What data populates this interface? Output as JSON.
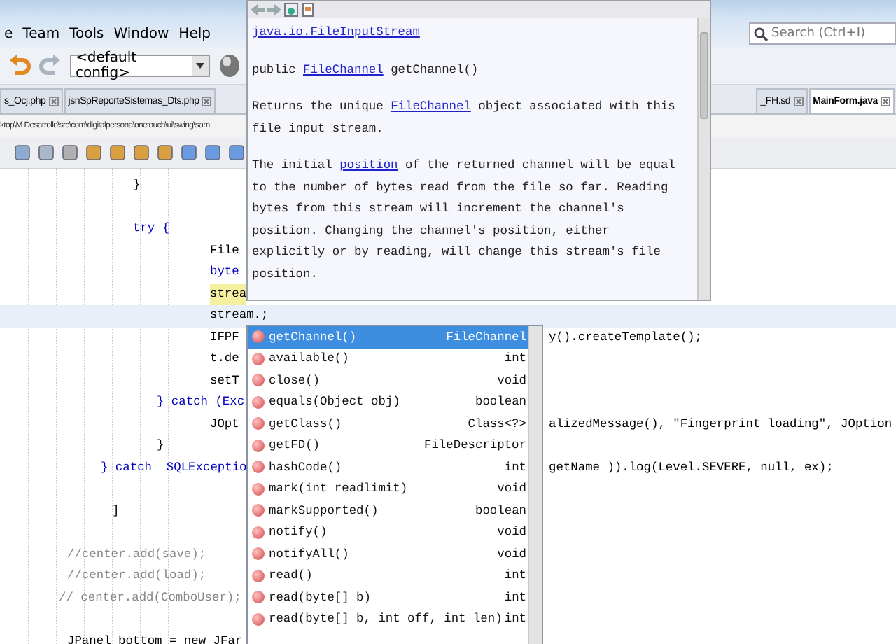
{
  "menu": [
    "e",
    "Team",
    "Tools",
    "Window",
    "Help"
  ],
  "search": {
    "placeholder": "Search (Ctrl+I)"
  },
  "toolbar": {
    "config": "<default config>"
  },
  "tabs_left": [
    {
      "label": "s_Ocj.php",
      "selected": false
    },
    {
      "label": "jsnSpReporteSistemas_Dts.php",
      "selected": false
    }
  ],
  "tabs_right": [
    {
      "label": "_FH.sd",
      "selected": false
    },
    {
      "label": "MainForm.java",
      "selected": true
    }
  ],
  "path": "ktop\\M Desarrollo\\src\\com\\digitalpersona\\onetouch\\ui\\swing\\sam",
  "code_lines": [
    {
      "left": "}",
      "kind": "code"
    },
    {
      "kind": "code"
    },
    {
      "left": "try {",
      "kind": "keyword"
    },
    {
      "left": "File",
      "kind": "code"
    },
    {
      "left": "byte",
      "kind": "keyword"
    },
    {
      "left": "strea",
      "kind": "occurrence"
    },
    {
      "left": "stream.;",
      "kind": "current"
    },
    {
      "left": "IFPF",
      "right": "y().createTemplate();",
      "kind": "code"
    },
    {
      "left": "t.de",
      "kind": "code"
    },
    {
      "left": "setT",
      "kind": "code"
    },
    {
      "left": "} catch (Exc",
      "kind": "keyword"
    },
    {
      "left": "JOpt",
      "right": "alizedMessage(), \"Fingerprint loading\", JOption",
      "kind": "code"
    },
    {
      "left": "}",
      "kind": "code"
    },
    {
      "left": "} catch  SQLExceptio",
      "right": "getName )).log(Level.SEVERE, null, ex);",
      "kind": "keyword"
    },
    {
      "kind": "code"
    },
    {
      "left": "]",
      "kind": "code"
    },
    {
      "kind": "code"
    },
    {
      "left": "//center.add(save);",
      "kind": "comment"
    },
    {
      "left": "//center.add(load);",
      "kind": "comment"
    },
    {
      "left": "// center.add(ComboUser);",
      "kind": "comment"
    },
    {
      "kind": "code"
    },
    {
      "left": "JPanel bottom = new JFar",
      "kind": "code"
    }
  ],
  "javadoc": {
    "class_link": "java.io.FileInputStream",
    "signature": [
      {
        "text": "public ",
        "link": false
      },
      {
        "text": "FileChannel",
        "link": true
      },
      {
        "text": " getChannel()",
        "link": false
      }
    ],
    "paragraphs": [
      [
        {
          "text": "Returns the unique ",
          "link": false
        },
        {
          "text": "FileChannel",
          "link": true
        },
        {
          "text": " object associated with this file input stream.",
          "link": false
        }
      ],
      [
        {
          "text": "The initial ",
          "link": false
        },
        {
          "text": "position",
          "link": true
        },
        {
          "text": " of the returned channel will be equal to the number of bytes read from the file so far. Reading bytes from this stream will increment the channel's position. Changing the channel's position, either explicitly or by reading, will change this stream's file position.",
          "link": false
        }
      ]
    ]
  },
  "completion": [
    {
      "name": "getChannel()",
      "type": "FileChannel",
      "selected": true
    },
    {
      "name": "available()",
      "type": "int",
      "selected": false
    },
    {
      "name": "close()",
      "type": "void",
      "selected": false
    },
    {
      "name": "equals(Object obj)",
      "type": "boolean",
      "selected": false
    },
    {
      "name": "getClass()",
      "type": "Class<?>",
      "selected": false
    },
    {
      "name": "getFD()",
      "type": "FileDescriptor",
      "selected": false
    },
    {
      "name": "hashCode()",
      "type": "int",
      "selected": false
    },
    {
      "name": "mark(int readlimit)",
      "type": "void",
      "selected": false
    },
    {
      "name": "markSupported()",
      "type": "boolean",
      "selected": false
    },
    {
      "name": "notify()",
      "type": "void",
      "selected": false
    },
    {
      "name": "notifyAll()",
      "type": "void",
      "selected": false
    },
    {
      "name": "read()",
      "type": "int",
      "selected": false
    },
    {
      "name": "read(byte[] b)",
      "type": "int",
      "selected": false
    },
    {
      "name": "read(byte[] b, int off, int len)",
      "type": "int",
      "selected": false
    }
  ]
}
